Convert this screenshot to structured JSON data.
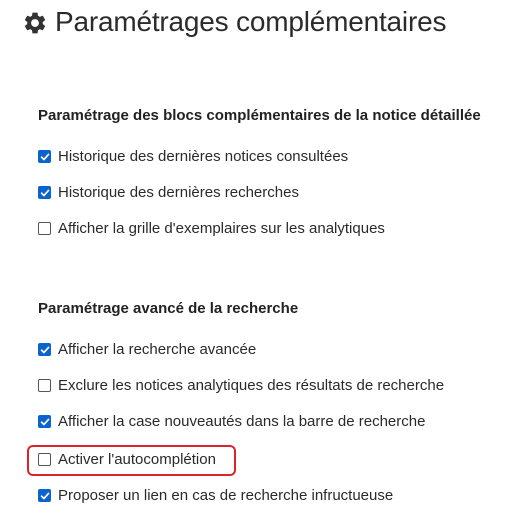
{
  "header": {
    "title": "Paramétrages complémentaires",
    "icon": "gear-icon"
  },
  "sections": [
    {
      "title": "Paramétrage des blocs complémentaires de la notice détaillée",
      "options": [
        {
          "label": "Historique des dernières notices consultées",
          "checked": true
        },
        {
          "label": "Historique des dernières recherches",
          "checked": true
        },
        {
          "label": "Afficher la grille d'exemplaires sur les analytiques",
          "checked": false
        }
      ]
    },
    {
      "title": "Paramétrage avancé de la recherche",
      "options": [
        {
          "label": "Afficher la recherche avancée",
          "checked": true
        },
        {
          "label": "Exclure les notices analytiques des résultats de recherche",
          "checked": false
        },
        {
          "label": "Afficher la case nouveautés dans la barre de recherche",
          "checked": true
        },
        {
          "label": "Activer l'autocomplétion",
          "checked": false,
          "highlighted": true
        },
        {
          "label": "Proposer un lien en cas de recherche infructueuse",
          "checked": true
        }
      ]
    }
  ],
  "colors": {
    "checkbox_checked": "#0b63ce",
    "highlight_border": "#d9262c",
    "text": "#222222"
  }
}
